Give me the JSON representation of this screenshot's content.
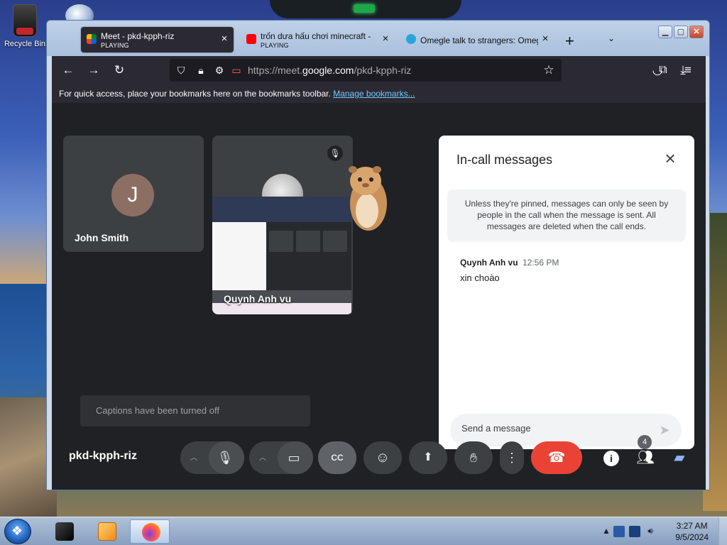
{
  "desktop": {
    "recycle_bin_label": "Recycle Bin"
  },
  "browser": {
    "tabs": [
      {
        "title": "Meet - pkd-kpph-riz",
        "subtitle": "PLAYING",
        "favicon": "meet-icon",
        "active": true
      },
      {
        "title": "trốn dưa hấu chơi minecraft - Y",
        "subtitle": "PLAYING",
        "favicon": "youtube-icon",
        "active": false
      },
      {
        "title": "Omegle talk to strangers: Omeg",
        "subtitle": "",
        "favicon": "omegle-icon",
        "active": false
      }
    ],
    "new_tab_icon": "+",
    "tab_list_icon": "⌄",
    "url_prefix": "https://meet.",
    "url_domain": "google.com",
    "url_path": "/pkd-kpph-riz",
    "bookmarks_text": "For quick access, place your bookmarks here on the bookmarks toolbar.",
    "bookmarks_link": "Manage bookmarks..."
  },
  "meet": {
    "participants": [
      {
        "name": "John Smith",
        "initial": "J",
        "avatar_color": "#8d6e63"
      },
      {
        "name": "Quynh Anh vu",
        "muted": true
      }
    ],
    "captions_text": "Captions have been turned off",
    "meeting_code": "pkd-kpph-riz",
    "people_count": "4",
    "chat": {
      "title": "In-call messages",
      "notice": "Unless they're pinned, messages can only be seen by people in the call when the message is sent. All messages are deleted when the call ends.",
      "messages": [
        {
          "sender": "Quynh Anh vu",
          "time": "12:56 PM",
          "text": "xin choào"
        }
      ],
      "input_placeholder": "Send a message"
    },
    "controls": [
      "mic",
      "camera",
      "captions",
      "emoji",
      "present",
      "raise-hand",
      "more",
      "end-call"
    ],
    "end_call_color": "#ea4335",
    "accent_color": "#8ab4f8"
  },
  "taskbar": {
    "time": "3:27 AM",
    "date": "9/5/2024"
  }
}
